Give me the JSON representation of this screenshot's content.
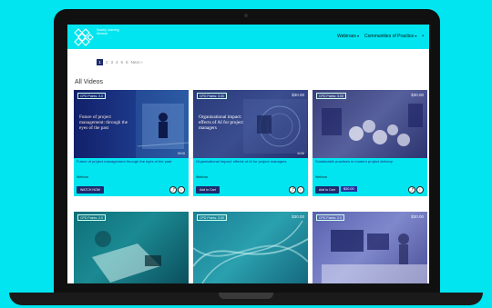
{
  "header": {
    "logo_text": "Society Learning Network",
    "nav": [
      {
        "label": "Webinars"
      },
      {
        "label": "Communities of Practice"
      }
    ]
  },
  "pager": {
    "current": "1",
    "pages": [
      "2",
      "3",
      "4",
      "5",
      "6"
    ],
    "next": "Next »"
  },
  "section_title": "All Videos",
  "cards": [
    {
      "badge": "CPD Points: 3.0",
      "price": "",
      "thumb_text": "Future of project management: through the eyes of the past",
      "duration": "55:06",
      "title": "Future of project management through the eyes of the past",
      "meta": "Webinar",
      "date": "",
      "button": "WATCH NOW",
      "price_tag": ""
    },
    {
      "badge": "CPD Points: 3.00",
      "price": "$30.00",
      "thumb_text": "Organisational impact: effects of AI for project managers",
      "duration": "44:56",
      "title": "Organisational impact: effects of AI for project managers",
      "meta": "Webinar",
      "date": "",
      "button": "Add to Cart",
      "price_tag": ""
    },
    {
      "badge": "CPD Points: 3.00",
      "price": "$30.00",
      "thumb_text": "",
      "duration": "",
      "title": "Sustainable practices in modern project delivery",
      "meta": "Webinar",
      "date": "",
      "button": "Add to Cart",
      "price_tag": "$30.00"
    },
    {
      "badge": "CPD Points: 2.0",
      "price": "",
      "thumb_text": "",
      "duration": ""
    },
    {
      "badge": "CPD Points: 3.00",
      "price": "$30.00",
      "thumb_text": "",
      "duration": ""
    },
    {
      "badge": "CPD Points: 2.0",
      "price": "$30.00",
      "thumb_text": "",
      "duration": ""
    }
  ],
  "colors": {
    "accent": "#00e5ef",
    "navy": "#1e2a6e"
  }
}
